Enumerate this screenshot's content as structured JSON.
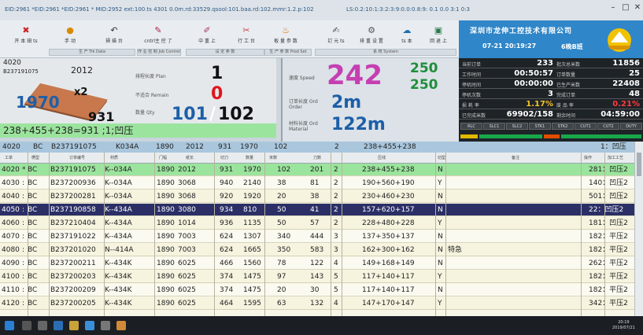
{
  "window": {
    "title_left": "EID:2961  *EID:2961  *EID:2961  * MID:2952 ext:100.ts  4301 0.0m.rd:33529.qsool:101.baa.rd:102.mmr:1.2.p:102",
    "title_right": "LS:0.2:10:1:3:2:3:9:0.0:0.8:9: 0.1 0.0 3:1 0:3"
  },
  "toolbar": {
    "buttons": [
      "开 本 田 ts",
      "手 动",
      "掃 描 台",
      "cntrl主 控 了",
      "中 重 上",
      "行 工 台",
      "板 量 参 数",
      "訂 元 ts",
      "排 重 设 置",
      "ts 本",
      "回 退 上"
    ],
    "groups": [
      "生 产 Trk Data",
      "作 业 控 制 Job Control",
      "设 定 参 数",
      "生 产 参 数 Prod Set",
      "系 统 System"
    ]
  },
  "header": {
    "company": "深圳市龙伸工控技术有限公司",
    "clock": "07-21 20:19:27",
    "shift": "6晚B班"
  },
  "panel1": {
    "order_code": "4020",
    "order_no": "B237191075",
    "width": "2012",
    "length": "1970",
    "multiplier": "x2",
    "board_width": "931",
    "label_planned": "排程长度 Plan",
    "label_remain": "不适合 Remain",
    "label_qty": "数量 Qty",
    "big1": "1",
    "big0": "0",
    "qty_done": "101",
    "qty_total": "102",
    "formula": "238+455+238=931 ;1;凹压"
  },
  "panel2": {
    "speed_label": "速度 Speed",
    "speed": "242",
    "speed_a": "250",
    "speed_b": "250",
    "order_len_label": "订单长度 Ord Order",
    "order_len": "2m",
    "material_label": "材料长度 Ord Material",
    "material_len": "122m"
  },
  "stats": {
    "rows": [
      {
        "l1": "当前订单",
        "v1": "233",
        "l2": "批次总米数",
        "v2": "11856"
      },
      {
        "l1": "工作时间",
        "v1": "00:50:57",
        "l2": "订单数量",
        "v2": "25"
      },
      {
        "l1": "停机时间",
        "v1": "00:00:00",
        "l2": "已生产米数",
        "v2": "22408"
      },
      {
        "l1": "停机次数",
        "v1": "3",
        "l2": "完成订单",
        "v2": "48"
      },
      {
        "l1": "损 耗 率",
        "v1": "1.17%",
        "l2": "废 品 率",
        "v2": "0.21%"
      },
      {
        "l1": "已完成米数",
        "v1": "69902/158",
        "l2": "剩余时间",
        "v2": "04:59:00"
      }
    ],
    "chips": [
      "RLC",
      "SLC1",
      "SLC2",
      "STK1",
      "STK2",
      "CUT1",
      "CUT2",
      "DUTY"
    ]
  },
  "summary": {
    "code": "4020",
    "bc": "BC",
    "order": "B237191075",
    "flute": "K034A",
    "wid": "1890",
    "len": "2012",
    "boardw": "931",
    "cut": "1970",
    "qty": "102",
    "prod": "2",
    "formula": "238+455+238",
    "note": "1：凹压"
  },
  "table": {
    "headers": [
      "工单",
      "楞型",
      "订单编号",
      "材质",
      "门幅",
      "纸长",
      "切刀",
      "数量",
      "米数",
      "刀数",
      "压线",
      "切型",
      "备注",
      "操作",
      "加工工艺"
    ],
    "rows": [
      {
        "code": "4020",
        "mark": "*",
        "bc": "BC",
        "order": "B237191075",
        "mat": "K--034A",
        "w": "1890",
        "l": "2012",
        "b": "931",
        "c": "1970",
        "q": "102",
        "r": "201",
        "n": "2",
        "f": "238+455+238",
        "y": "N",
        "note": "",
        "p": "281：凹压2"
      },
      {
        "code": "4030",
        "mark": ":",
        "bc": "BC",
        "order": "B237200936",
        "mat": "K--034A",
        "w": "1890",
        "l": "3068",
        "b": "940",
        "c": "2140",
        "q": "38",
        "r": "81",
        "n": "2",
        "f": "190+560+190",
        "y": "Y",
        "note": "",
        "p": "140：凹压2"
      },
      {
        "code": "4040",
        "mark": ":",
        "bc": "BC",
        "order": "B237200281",
        "mat": "K--034A",
        "w": "1890",
        "l": "3068",
        "b": "920",
        "c": "1920",
        "q": "20",
        "r": "38",
        "n": "2",
        "f": "230+460+230",
        "y": "N",
        "note": "",
        "p": "501：凹压2"
      },
      {
        "code": "4050",
        "mark": ":",
        "bc": "BC",
        "order": "B237190858",
        "mat": "K--434A",
        "w": "1890",
        "l": "3080",
        "b": "934",
        "c": "810",
        "q": "50",
        "r": "41",
        "n": "2",
        "f": "157+620+157",
        "y": "N",
        "note": "",
        "p": "22：凹压2"
      },
      {
        "code": "4060",
        "mark": ":",
        "bc": "BC",
        "order": "B237210404",
        "mat": "K--434A",
        "w": "1890",
        "l": "1014",
        "b": "936",
        "c": "1135",
        "q": "50",
        "r": "57",
        "n": "2",
        "f": "228+480+228",
        "y": "Y",
        "note": "",
        "p": "181：凹压2"
      },
      {
        "code": "4070",
        "mark": ":",
        "bc": "BC",
        "order": "B237191022",
        "mat": "K--434A",
        "w": "1890",
        "l": "7003",
        "b": "624",
        "c": "1307",
        "q": "340",
        "r": "444",
        "n": "3",
        "f": "137+350+137",
        "y": "N",
        "note": "",
        "p": "182：平压2"
      },
      {
        "code": "4080",
        "mark": ":",
        "bc": "BC",
        "order": "B237201020",
        "mat": "N--414A",
        "w": "1890",
        "l": "7003",
        "b": "624",
        "c": "1665",
        "q": "350",
        "r": "583",
        "n": "3",
        "f": "162+300+162",
        "y": "N",
        "note": "特急",
        "p": "182：平压2"
      },
      {
        "code": "4090",
        "mark": ":",
        "bc": "BC",
        "order": "B237200211",
        "mat": "K--434K",
        "w": "1890",
        "l": "6025",
        "b": "466",
        "c": "1560",
        "q": "78",
        "r": "122",
        "n": "4",
        "f": "149+168+149",
        "y": "N",
        "note": "",
        "p": "262：平压2"
      },
      {
        "code": "4100",
        "mark": ":",
        "bc": "BC",
        "order": "B237200203",
        "mat": "K--434K",
        "w": "1890",
        "l": "6025",
        "b": "374",
        "c": "1475",
        "q": "97",
        "r": "143",
        "n": "5",
        "f": "117+140+117",
        "y": "Y",
        "note": "",
        "p": "182：平压2"
      },
      {
        "code": "4110",
        "mark": ":",
        "bc": "BC",
        "order": "B237200209",
        "mat": "K--434K",
        "w": "1890",
        "l": "6025",
        "b": "374",
        "c": "1475",
        "q": "20",
        "r": "30",
        "n": "5",
        "f": "117+140+117",
        "y": "N",
        "note": "",
        "p": "182：平压2"
      },
      {
        "code": "4120",
        "mark": ":",
        "bc": "BC",
        "order": "B237200205",
        "mat": "K--434K",
        "w": "1890",
        "l": "6025",
        "b": "464",
        "c": "1595",
        "q": "63",
        "r": "132",
        "n": "4",
        "f": "147+170+147",
        "y": "Y",
        "note": "",
        "p": "342：平压2"
      }
    ]
  },
  "taskbar": {
    "time": "20:19",
    "date": "2019/07/21"
  }
}
